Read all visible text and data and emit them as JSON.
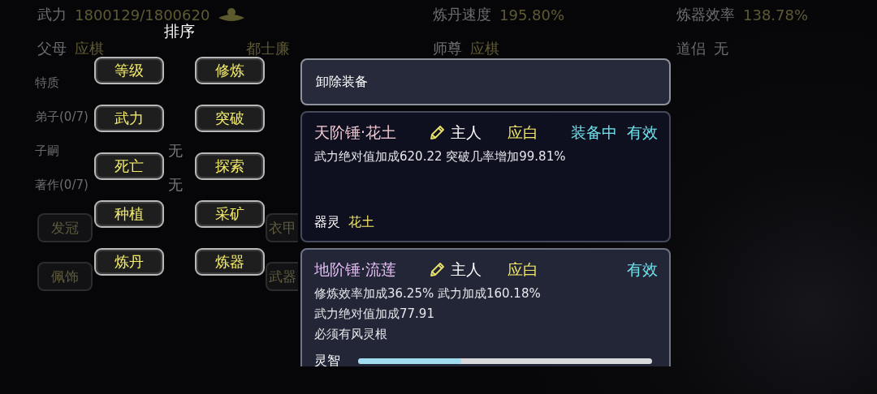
{
  "top_stats": [
    {
      "label": "武力",
      "value": "1800129/1800620",
      "kind": "power"
    },
    {
      "label": "炼丹速度",
      "value": "195.80%",
      "kind": "plain"
    },
    {
      "label": "炼器效率",
      "value": "138.78%",
      "kind": "plain"
    }
  ],
  "relations": [
    {
      "label": "父母",
      "values": [
        {
          "text": "应棋",
          "kind": "name"
        },
        {
          "text": "都士廉",
          "kind": "name"
        }
      ]
    },
    {
      "label": "师尊",
      "values": [
        {
          "text": "应棋",
          "kind": "name"
        }
      ]
    },
    {
      "label": "道侣",
      "values": [
        {
          "text": "无",
          "kind": "empty"
        }
      ]
    }
  ],
  "details": [
    {
      "label": "特质"
    },
    {
      "label": "弟子(0/7)"
    },
    {
      "label": "子嗣",
      "value": "无"
    },
    {
      "label": "著作(0/7)",
      "value": "无"
    }
  ],
  "slots": [
    {
      "left": "发冠",
      "right": "衣甲"
    },
    {
      "left": "佩饰",
      "right": "武器"
    }
  ],
  "sort_menu": {
    "title": "排序",
    "options": [
      "等级",
      "修炼",
      "武力",
      "突破",
      "死亡",
      "探索",
      "种植",
      "采矿",
      "炼丹",
      "炼器"
    ]
  },
  "equipment": {
    "unequip_label": "卸除装备",
    "items": [
      {
        "name": "天阶锤·花土",
        "color": "#f2c9d2",
        "owner_label": "主人",
        "owner": "应白",
        "status": "装备中",
        "validity": "有效",
        "effects": [
          "武力绝对值加成620.22 突破几率增加99.81%"
        ],
        "footer": {
          "kind": "spirit",
          "label": "器灵",
          "value": "花土"
        }
      },
      {
        "name": "地阶锤·流莲",
        "color": "#e3bdf2",
        "owner_label": "主人",
        "owner": "应白",
        "validity": "有效",
        "effects": [
          "修炼效率加成36.25% 武力加成160.18%",
          "武力绝对值加成77.91",
          "必须有风灵根"
        ],
        "footer": {
          "kind": "meter",
          "label": "灵智",
          "level": 0.35
        }
      }
    ]
  }
}
